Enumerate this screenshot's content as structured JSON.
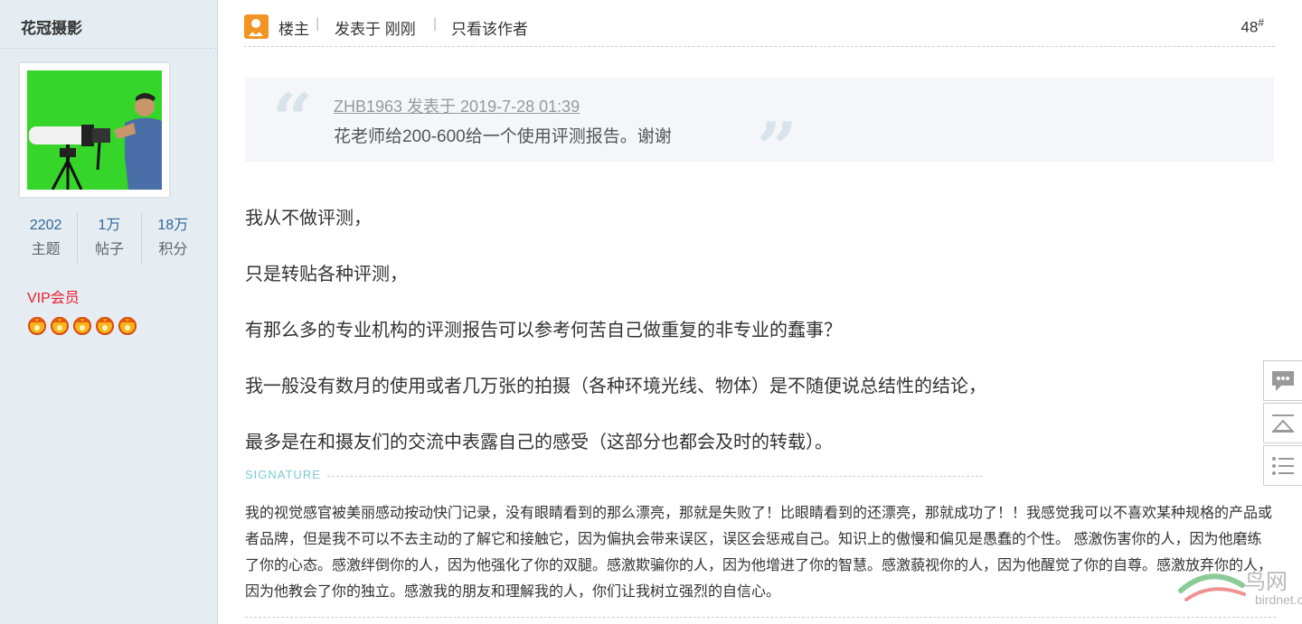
{
  "author": {
    "name": "花冠摄影",
    "stats": [
      {
        "value": "2202",
        "label": "主题"
      },
      {
        "value": "1万",
        "label": "帖子"
      },
      {
        "value": "18万",
        "label": "积分"
      }
    ],
    "group": "VIP会员",
    "badge_count": 5
  },
  "post": {
    "op_label": "楼主",
    "separator": "|",
    "posted_text": "发表于 刚刚",
    "only_author": "只看该作者",
    "floor_number": "48",
    "floor_symbol": "#",
    "quote": {
      "meta": "ZHB1963 发表于 2019-7-28 01:39",
      "text": "花老师给200-600给一个使用评测报告。谢谢"
    },
    "paragraphs": [
      "我从不做评测，",
      "只是转贴各种评测，",
      "有那么多的专业机构的评测报告可以参考何苦自己做重复的非专业的蠢事？",
      "我一般没有数月的使用或者几万张的拍摄（各种环境光线、物体）是不随便说总结性的结论，",
      "最多是在和摄友们的交流中表露自己的感受（这部分也都会及时的转载）。"
    ],
    "signature_label": "SIGNATURE",
    "signature": "我的视觉感官被美丽感动按动快门记录，没有眼睛看到的那么漂亮，那就是失败了！比眼睛看到的还漂亮，那就成功了！！我感觉我可以不喜欢某种规格的产品或者品牌，但是我不可以不去主动的了解它和接触它，因为偏执会带来误区，误区会惩戒自己。知识上的傲慢和偏见是愚蠢的个性。 感激伤害你的人，因为他磨练了你的心态。感激绊倒你的人，因为他强化了你的双腿。感激欺骗你的人，因为他增进了你的智慧。感激藐视你的人，因为他醒觉了你的自尊。感激放弃你的人，因为他教会了你的独立。感激我的朋友和理解我的人，你们让我树立强烈的自信心。"
  },
  "side_tools": [
    "comment-icon",
    "back-to-top-icon",
    "list-icon"
  ],
  "watermark": {
    "text": "鸟网",
    "url": "birdnet.cn"
  },
  "colors": {
    "sidebar_bg": "#e5edf2",
    "link_blue": "#336699",
    "vip_red": "#ee1b2e",
    "op_orange": "#f29322",
    "quote_bg": "#f5f6f9"
  }
}
